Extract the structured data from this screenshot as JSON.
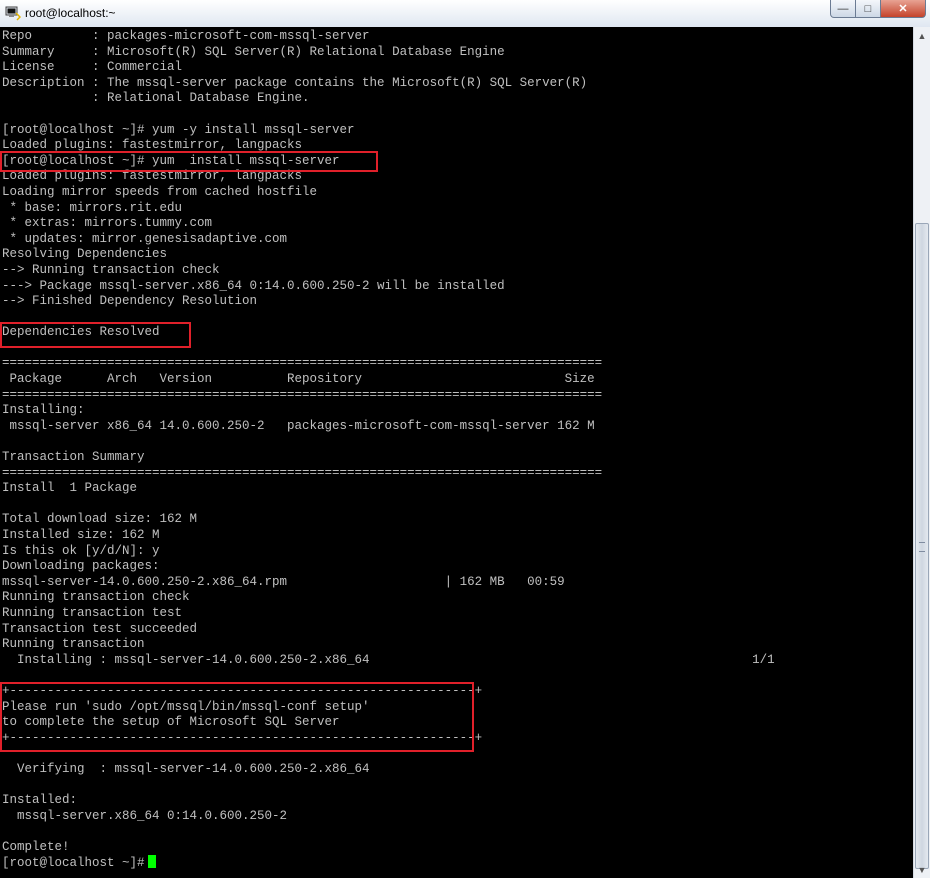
{
  "window": {
    "title": "root@localhost:~",
    "buttons": {
      "minimize": "—",
      "maximize": "□",
      "close": "✕"
    }
  },
  "terminal": {
    "lines": [
      "Repo        : packages-microsoft-com-mssql-server",
      "Summary     : Microsoft(R) SQL Server(R) Relational Database Engine",
      "License     : Commercial",
      "Description : The mssql-server package contains the Microsoft(R) SQL Server(R)",
      "            : Relational Database Engine.",
      "",
      "[root@localhost ~]# yum -y install mssql-server",
      "Loaded plugins: fastestmirror, langpacks",
      "[root@localhost ~]# yum  install mssql-server",
      "Loaded plugins: fastestmirror, langpacks",
      "Loading mirror speeds from cached hostfile",
      " * base: mirrors.rit.edu",
      " * extras: mirrors.tummy.com",
      " * updates: mirror.genesisadaptive.com",
      "Resolving Dependencies",
      "--> Running transaction check",
      "---> Package mssql-server.x86_64 0:14.0.600.250-2 will be installed",
      "--> Finished Dependency Resolution",
      "",
      "Dependencies Resolved",
      "",
      "================================================================================",
      " Package      Arch   Version          Repository                           Size",
      "================================================================================",
      "Installing:",
      " mssql-server x86_64 14.0.600.250-2   packages-microsoft-com-mssql-server 162 M",
      "",
      "Transaction Summary",
      "================================================================================",
      "Install  1 Package",
      "",
      "Total download size: 162 M",
      "Installed size: 162 M",
      "Is this ok [y/d/N]: y",
      "Downloading packages:",
      "mssql-server-14.0.600.250-2.x86_64.rpm                     | 162 MB   00:59",
      "Running transaction check",
      "Running transaction test",
      "Transaction test succeeded",
      "Running transaction",
      "  Installing : mssql-server-14.0.600.250-2.x86_64                                                   1/1",
      "",
      "+--------------------------------------------------------------+",
      "Please run 'sudo /opt/mssql/bin/mssql-conf setup'",
      "to complete the setup of Microsoft SQL Server",
      "+--------------------------------------------------------------+",
      "",
      "  Verifying  : mssql-server-14.0.600.250-2.x86_64",
      "",
      "Installed:",
      "  mssql-server.x86_64 0:14.0.600.250-2",
      "",
      "Complete!"
    ],
    "prompt": "[root@localhost ~]#",
    "colors": {
      "background": "#000000",
      "foreground": "#c0c0c0",
      "cursor": "#00ff00",
      "highlight": "#e0202a"
    }
  }
}
